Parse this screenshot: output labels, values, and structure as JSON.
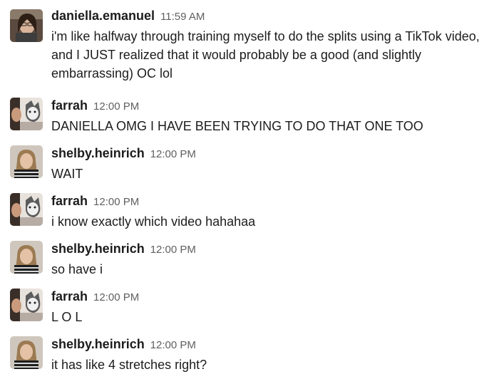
{
  "messages": [
    {
      "author": "daniella.emanuel",
      "time": "11:59 AM",
      "text": "i'm like halfway through training myself to do the splits using a TikTok video, and I JUST realized that it would probably be a good (and slightly embarrassing) OC lol",
      "avatar": "daniella-avatar"
    },
    {
      "author": "farrah",
      "time": "12:00 PM",
      "text": "DANIELLA OMG I HAVE BEEN TRYING TO DO THAT ONE TOO",
      "avatar": "farrah-avatar"
    },
    {
      "author": "shelby.heinrich",
      "time": "12:00 PM",
      "text": "WAIT",
      "avatar": "shelby-avatar"
    },
    {
      "author": "farrah",
      "time": "12:00 PM",
      "text": "i know exactly which video hahahaa",
      "avatar": "farrah-avatar"
    },
    {
      "author": "shelby.heinrich",
      "time": "12:00 PM",
      "text": "so have i",
      "avatar": "shelby-avatar"
    },
    {
      "author": "farrah",
      "time": "12:00 PM",
      "text": "L O L",
      "avatar": "farrah-avatar"
    },
    {
      "author": "shelby.heinrich",
      "time": "12:00 PM",
      "text": "it has like 4 stretches right?",
      "avatar": "shelby-avatar"
    }
  ]
}
